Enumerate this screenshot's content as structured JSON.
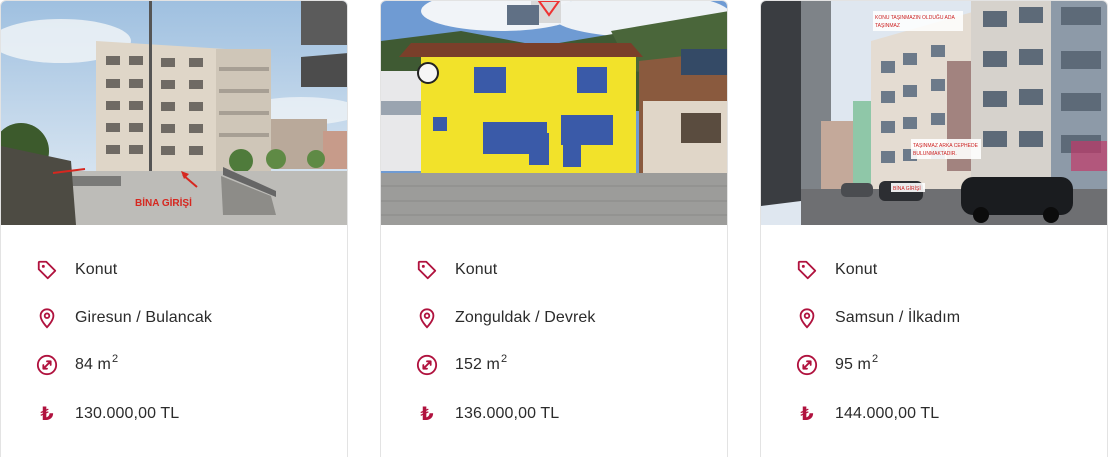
{
  "accent_color": "#b0123e",
  "listings": [
    {
      "type": "Konut",
      "location": "Giresun / Bulancak",
      "area": "84 m",
      "area_unit_exp": "2",
      "price": "130.000,00 TL",
      "photo_caption": "BİNA GİRİŞİ"
    },
    {
      "type": "Konut",
      "location": "Zonguldak / Devrek",
      "area": "152 m",
      "area_unit_exp": "2",
      "price": "136.000,00 TL"
    },
    {
      "type": "Konut",
      "location": "Samsun / İlkadım",
      "area": "95 m",
      "area_unit_exp": "2",
      "price": "144.000,00 TL",
      "photo_caption_top_1": "KONU TAŞINMAZIN OLDUĞU ADA",
      "photo_caption_top_2": "TAŞINMAZ",
      "photo_caption_mid_1": "TAŞINMAZ ARKA CEPHEDE",
      "photo_caption_mid_2": "BULUNMAKTADIR.",
      "photo_caption_bottom": "BİNA GİRİŞİ"
    }
  ],
  "icons": {
    "type": "tag-icon",
    "location": "location-pin-icon",
    "area": "area-arrow-icon",
    "price": "turkish-lira-icon"
  },
  "currency_symbol": "₺"
}
